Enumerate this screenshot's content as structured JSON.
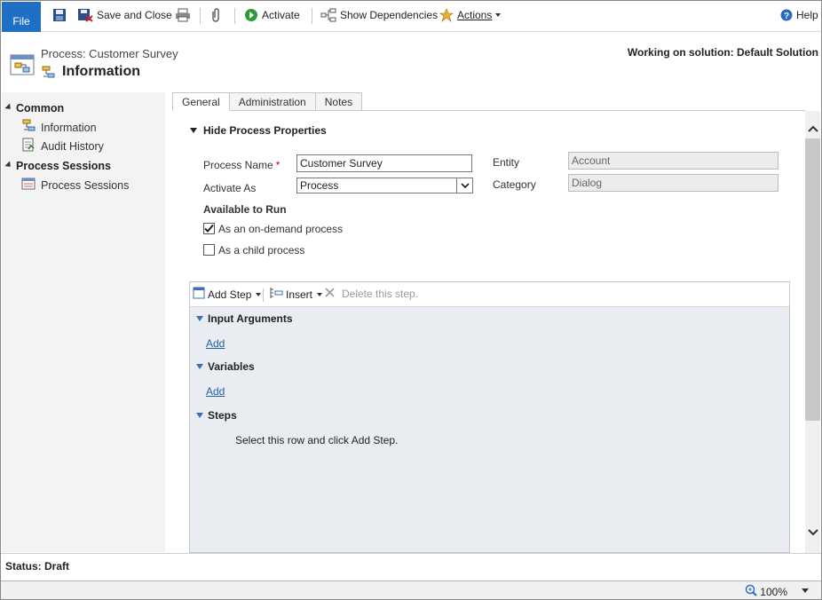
{
  "ribbon": {
    "file_label": "File",
    "save_close_label": "Save and Close",
    "activate_label": "Activate",
    "show_dependencies_label": "Show Dependencies",
    "actions_label": "Actions",
    "help_label": "Help"
  },
  "header": {
    "process_line": "Process: Customer Survey",
    "title": "Information",
    "solution_text": "Working on solution: Default Solution"
  },
  "leftnav": {
    "sections": [
      {
        "label": "Common",
        "items": [
          {
            "label": "Information",
            "icon": "process-icon"
          },
          {
            "label": "Audit History",
            "icon": "audit-history-icon"
          }
        ]
      },
      {
        "label": "Process Sessions",
        "items": [
          {
            "label": "Process Sessions",
            "icon": "process-sessions-icon"
          }
        ]
      }
    ]
  },
  "tabs": [
    {
      "label": "General",
      "active": true
    },
    {
      "label": "Administration",
      "active": false
    },
    {
      "label": "Notes",
      "active": false
    }
  ],
  "form": {
    "section_title": "Hide Process Properties",
    "process_name_label": "Process Name",
    "required_mark": "*",
    "process_name_value": "Customer Survey",
    "activate_as_label": "Activate As",
    "activate_as_value": "Process",
    "entity_label": "Entity",
    "entity_value": "Account",
    "category_label": "Category",
    "category_value": "Dialog",
    "available_to_run_label": "Available to Run",
    "on_demand_label": "As an on-demand process",
    "on_demand_checked": true,
    "child_process_label": "As a child process",
    "child_process_checked": false
  },
  "designer": {
    "add_step_label": "Add Step",
    "insert_label": "Insert",
    "delete_label": "Delete this step.",
    "input_arguments_label": "Input Arguments",
    "add_link_1": "Add",
    "variables_label": "Variables",
    "add_link_2": "Add",
    "steps_label": "Steps",
    "steps_hint": "Select this row and click Add Step."
  },
  "status": {
    "text": "Status: Draft",
    "zoom": "100%"
  },
  "colors": {
    "file_button": "#1f6fc5",
    "link": "#1f5fa6",
    "designer_bg": "#e9edf1",
    "nav_bg": "#f3f3f3"
  }
}
